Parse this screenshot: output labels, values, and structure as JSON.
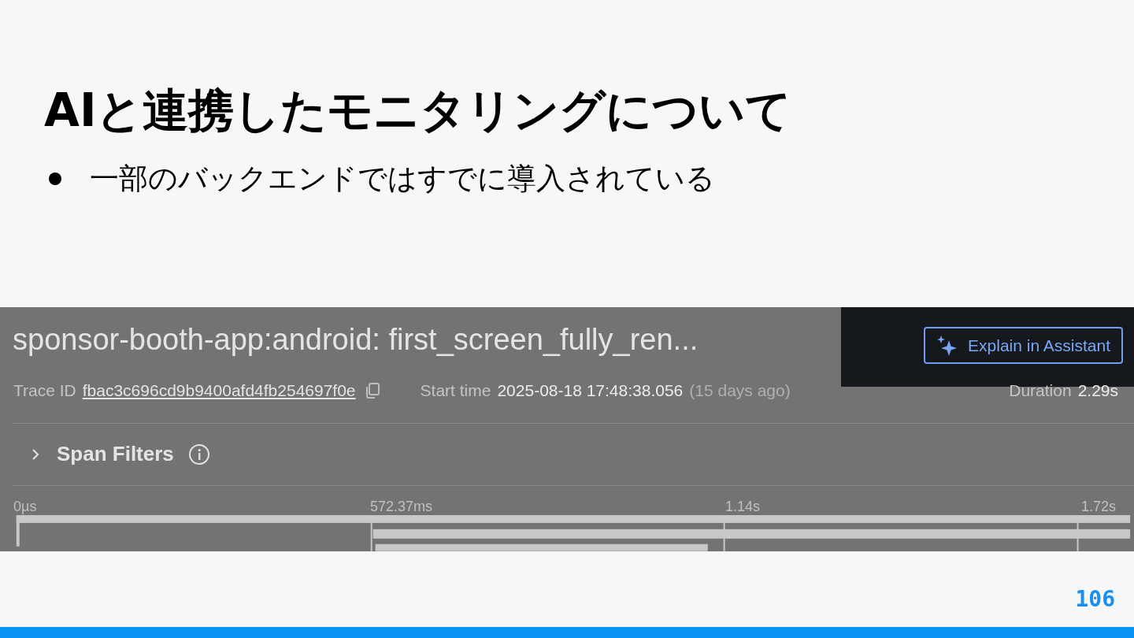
{
  "slide": {
    "title": "AIと連携したモニタリングについて",
    "bullets": [
      "一部のバックエンドではすでに導入されている"
    ],
    "page_number": "106"
  },
  "screenshot": {
    "title": "sponsor-booth-app:android: first_screen_fully_ren...",
    "assistant_button": {
      "label": "Explain in Assistant"
    },
    "meta": {
      "trace_label": "Trace ID",
      "trace_id": "fbac3c696cd9b9400afd4fb254697f0e",
      "start_label": "Start time",
      "start_value": "2025-08-18 17:48:38.056",
      "start_relative": "(15 days ago)",
      "duration_label": "Duration",
      "duration_value": "2.29s"
    },
    "span_filters": {
      "label": "Span Filters",
      "expanded": false
    },
    "timeline": {
      "ticks": [
        "0µs",
        "572.37ms",
        "1.14s",
        "1.72s"
      ]
    }
  }
}
